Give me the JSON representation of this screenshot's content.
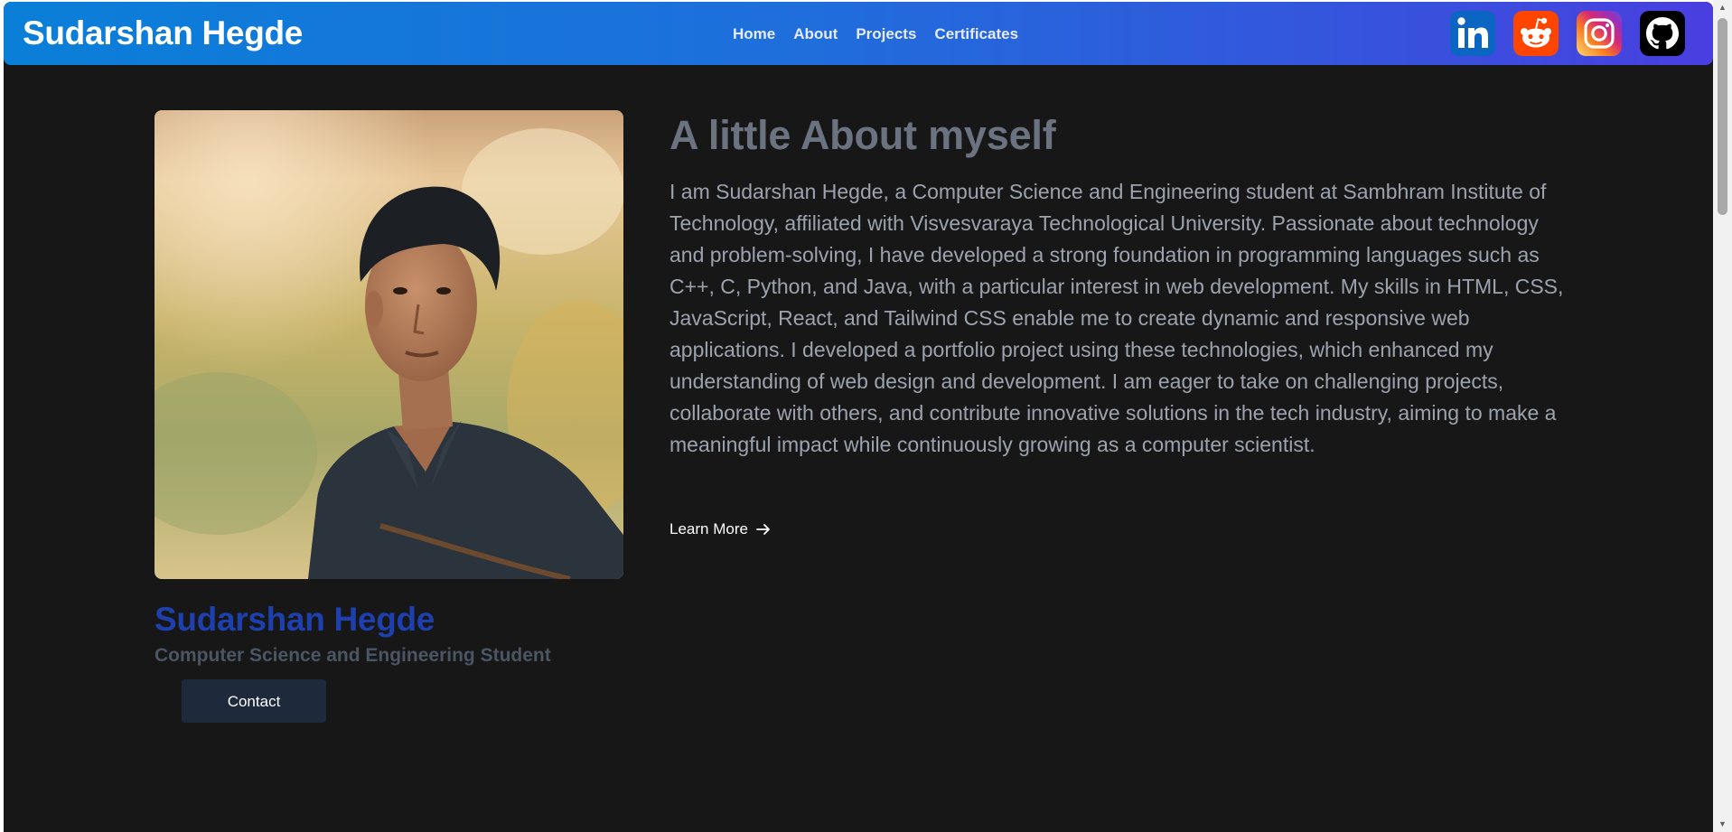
{
  "header": {
    "brand": "Sudarshan Hegde",
    "nav": [
      "Home",
      "About",
      "Projects",
      "Certificates"
    ],
    "socials": [
      "linkedin-icon",
      "reddit-icon",
      "instagram-icon",
      "github-icon"
    ]
  },
  "profile": {
    "name": "Sudarshan Hegde",
    "role": "Computer Science and Engineering Student",
    "contact_label": "Contact"
  },
  "about": {
    "heading": "A little About myself",
    "body": "I am Sudarshan Hegde, a Computer Science and Engineering student at Sambhram Institute of Technology, affiliated with Visvesvaraya Technological University. Passionate about technology and problem-solving, I have developed a strong foundation in programming languages such as C++, C, Python, and Java, with a particular interest in web development. My skills in HTML, CSS, JavaScript, React, and Tailwind CSS enable me to create dynamic and responsive web applications. I developed a portfolio project using these technologies, which enhanced my understanding of web design and development. I am eager to take on challenging projects, collaborate with others, and contribute innovative solutions in the tech industry, aiming to make a meaningful impact while continuously growing as a computer scientist.",
    "learn_more_label": "Learn More"
  },
  "colors": {
    "page_bg": "#171717",
    "nav_gradient_start": "#0a7fd8",
    "nav_gradient_end": "#4a3ee0",
    "name_accent": "#1e40af",
    "contact_button": "#1e293b"
  }
}
